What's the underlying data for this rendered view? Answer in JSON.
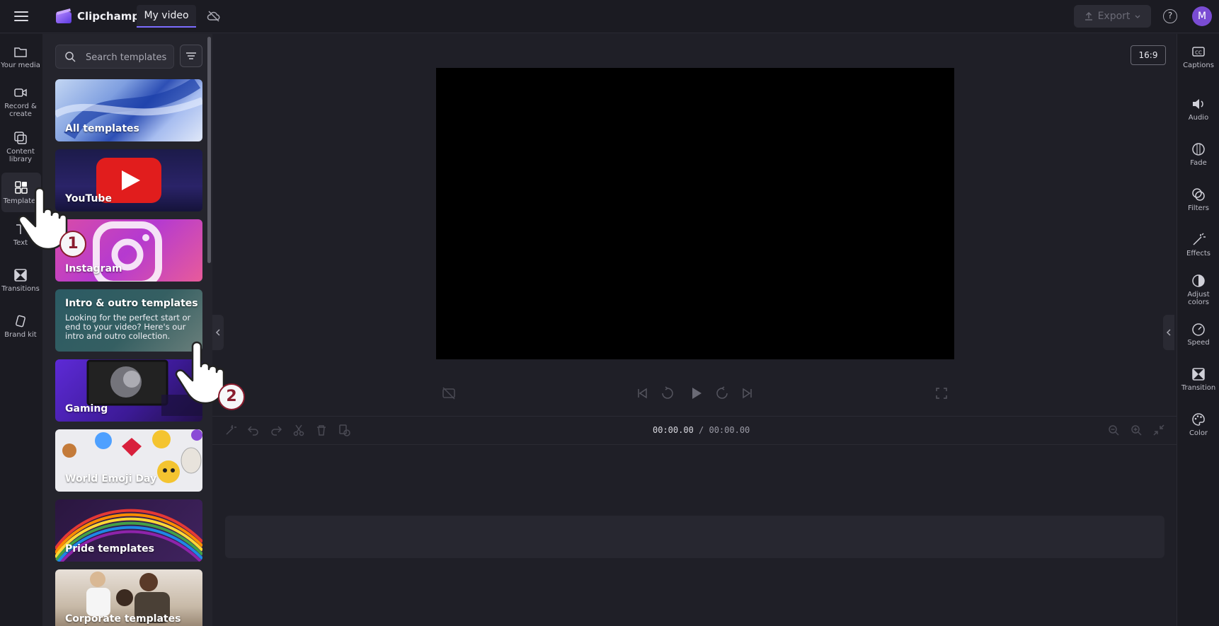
{
  "topbar": {
    "brand": "Clipchamp",
    "project_tab": "My video",
    "export_label": "Export",
    "help_label": "?",
    "avatar_initial": "M"
  },
  "left_rail": {
    "items": [
      {
        "label1": "Your media",
        "label2": ""
      },
      {
        "label1": "Record &",
        "label2": "create"
      },
      {
        "label1": "Content",
        "label2": "library"
      },
      {
        "label1": "Templates",
        "label2": ""
      },
      {
        "label1": "Text",
        "label2": ""
      },
      {
        "label1": "Transitions",
        "label2": ""
      },
      {
        "label1": "Brand kit",
        "label2": ""
      }
    ]
  },
  "templates_panel": {
    "search_placeholder": "Search templates",
    "cards": [
      {
        "label": "All templates"
      },
      {
        "label": "YouTube"
      },
      {
        "label": "Instagram"
      },
      {
        "label": "Intro & outro templates",
        "desc": "Looking for the perfect start or end to your video? Here's our intro and outro collection."
      },
      {
        "label": "Gaming"
      },
      {
        "label": "World Emoji Day"
      },
      {
        "label": "Pride templates"
      },
      {
        "label": "Corporate templates"
      }
    ]
  },
  "stage": {
    "aspect_ratio": "16:9"
  },
  "timeline": {
    "current_time": "00:00.00",
    "total_time": "/ 00:00.00"
  },
  "right_rail": {
    "items": [
      {
        "label1": "Captions",
        "label2": ""
      },
      {
        "label1": "Audio",
        "label2": ""
      },
      {
        "label1": "Fade",
        "label2": ""
      },
      {
        "label1": "Filters",
        "label2": ""
      },
      {
        "label1": "Effects",
        "label2": ""
      },
      {
        "label1": "Adjust",
        "label2": "colors"
      },
      {
        "label1": "Speed",
        "label2": ""
      },
      {
        "label1": "Transition",
        "label2": ""
      },
      {
        "label1": "Color",
        "label2": ""
      }
    ]
  },
  "annotations": {
    "step1": "1",
    "step2": "2"
  },
  "colors": {
    "accent": "#7b6cff",
    "avatar": "#7a4cd3",
    "badge_border": "#8a1c2e"
  }
}
